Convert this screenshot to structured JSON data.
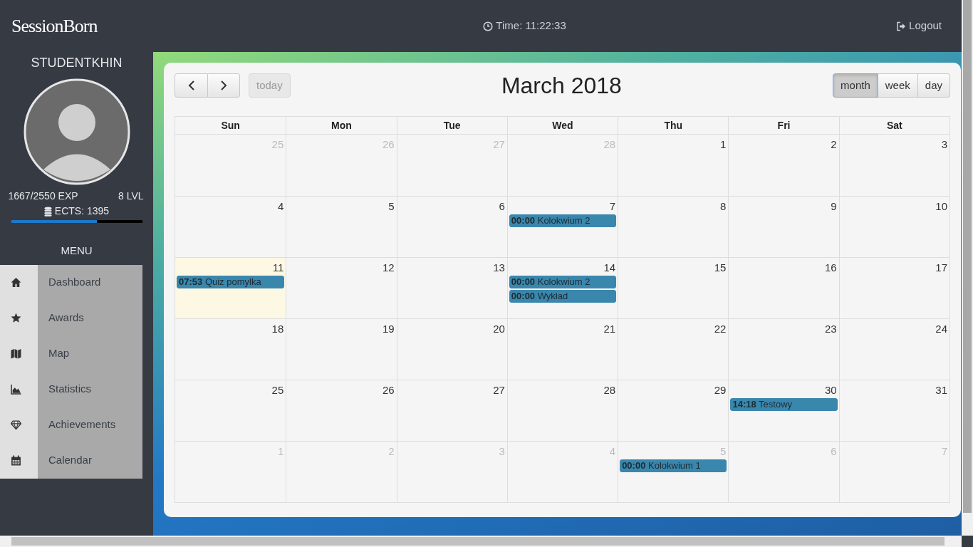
{
  "header": {
    "logo": "SessionBorn",
    "time": "Time: 11:22:33",
    "logout": "Logout"
  },
  "profile": {
    "username": "STUDENTKHIN",
    "exp": "1667/2550 EXP",
    "level_text": "8 LVL",
    "ects": "ECTS: 1395",
    "exp_bar": {
      "level": 0.654
    }
  },
  "menu": {
    "title": "MENU",
    "items": [
      {
        "kind": "home",
        "label": "Dashboard"
      },
      {
        "kind": "star",
        "label": "Awards"
      },
      {
        "kind": "map",
        "label": "Map"
      },
      {
        "kind": "chart",
        "label": "Statistics"
      },
      {
        "kind": "diamond",
        "label": "Achievements"
      },
      {
        "kind": "calendar",
        "label": "Calendar"
      }
    ]
  },
  "calendar": {
    "title": "March 2018",
    "today_button": {
      "label": "today",
      "disabled": true
    },
    "views": [
      {
        "label": "month",
        "selected": true
      },
      {
        "label": "week",
        "selected": false
      },
      {
        "label": "day",
        "selected": false
      }
    ],
    "weekdays": [
      "Sun",
      "Mon",
      "Tue",
      "Wed",
      "Thu",
      "Fri",
      "Sat"
    ],
    "weeks": [
      [
        {
          "day": "25",
          "other_month": true
        },
        {
          "day": "26",
          "other_month": true
        },
        {
          "day": "27",
          "other_month": true
        },
        {
          "day": "28",
          "other_month": true
        },
        {
          "day": "1"
        },
        {
          "day": "2"
        },
        {
          "day": "3"
        }
      ],
      [
        {
          "day": "4"
        },
        {
          "day": "5"
        },
        {
          "day": "6"
        },
        {
          "day": "7",
          "events": [
            {
              "time": "00:00",
              "title": "Kolokwium 2"
            }
          ]
        },
        {
          "day": "8"
        },
        {
          "day": "9"
        },
        {
          "day": "10"
        }
      ],
      [
        {
          "day": "11",
          "today": true,
          "events": [
            {
              "time": "07:53",
              "title": "Quiz pomylka"
            }
          ]
        },
        {
          "day": "12"
        },
        {
          "day": "13"
        },
        {
          "day": "14",
          "events": [
            {
              "time": "00:00",
              "title": "Kolokwium 2"
            },
            {
              "time": "00:00",
              "title": "Wykład"
            }
          ]
        },
        {
          "day": "15"
        },
        {
          "day": "16"
        },
        {
          "day": "17"
        }
      ],
      [
        {
          "day": "18"
        },
        {
          "day": "19"
        },
        {
          "day": "20"
        },
        {
          "day": "21"
        },
        {
          "day": "22"
        },
        {
          "day": "23"
        },
        {
          "day": "24"
        }
      ],
      [
        {
          "day": "25"
        },
        {
          "day": "26"
        },
        {
          "day": "27"
        },
        {
          "day": "28"
        },
        {
          "day": "29"
        },
        {
          "day": "30",
          "events": [
            {
              "time": "14:18",
              "title": "Testowy"
            }
          ]
        },
        {
          "day": "31"
        }
      ],
      [
        {
          "day": "1",
          "other_month": true
        },
        {
          "day": "2",
          "other_month": true
        },
        {
          "day": "3",
          "other_month": true
        },
        {
          "day": "4",
          "other_month": true
        },
        {
          "day": "5",
          "other_month": true,
          "events": [
            {
              "time": "00:00",
              "title": "Kolokwium 1"
            }
          ]
        },
        {
          "day": "6",
          "other_month": true
        },
        {
          "day": "7",
          "other_month": true
        }
      ]
    ]
  }
}
